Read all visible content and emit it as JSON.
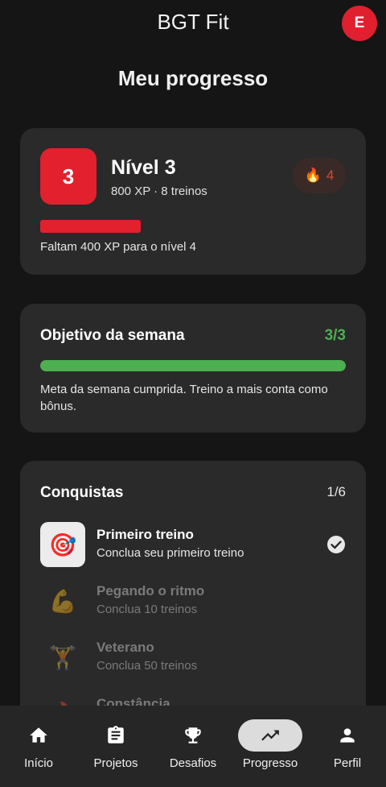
{
  "app": {
    "title": "BGT Fit",
    "avatar_letter": "E"
  },
  "page": {
    "title": "Meu progresso"
  },
  "level": {
    "badge": "3",
    "title": "Nível 3",
    "subtitle": "800 XP · 8 treinos",
    "streak": "4",
    "xp_progress": 0.33,
    "note": "Faltam 400 XP para o nível 4"
  },
  "goal": {
    "title": "Objetivo da semana",
    "count": "3/3",
    "progress": 1.0,
    "note": "Meta da semana cumprida. Treino a mais conta como bônus."
  },
  "achievements": {
    "title": "Conquistas",
    "count": "1/6",
    "items": [
      {
        "icon": "🎯",
        "name": "Primeiro treino",
        "desc": "Conclua seu primeiro treino",
        "unlocked": true
      },
      {
        "icon": "💪",
        "name": "Pegando o ritmo",
        "desc": "Conclua 10 treinos",
        "unlocked": false
      },
      {
        "icon": "🏋",
        "name": "Veterano",
        "desc": "Conclua 50 treinos",
        "unlocked": false
      },
      {
        "icon": "🔥",
        "name": "Constância",
        "desc": "",
        "unlocked": false
      }
    ]
  },
  "nav": {
    "items": [
      {
        "label": "Início",
        "icon": "home-icon"
      },
      {
        "label": "Projetos",
        "icon": "clipboard-icon"
      },
      {
        "label": "Desafios",
        "icon": "trophy-icon"
      },
      {
        "label": "Progresso",
        "icon": "trending-up-icon",
        "active": true
      },
      {
        "label": "Perfil",
        "icon": "person-icon"
      }
    ]
  },
  "colors": {
    "accent_red": "#e3202e",
    "success_green": "#4caf50",
    "card_bg": "#2a2a2a",
    "page_bg": "#151515"
  }
}
